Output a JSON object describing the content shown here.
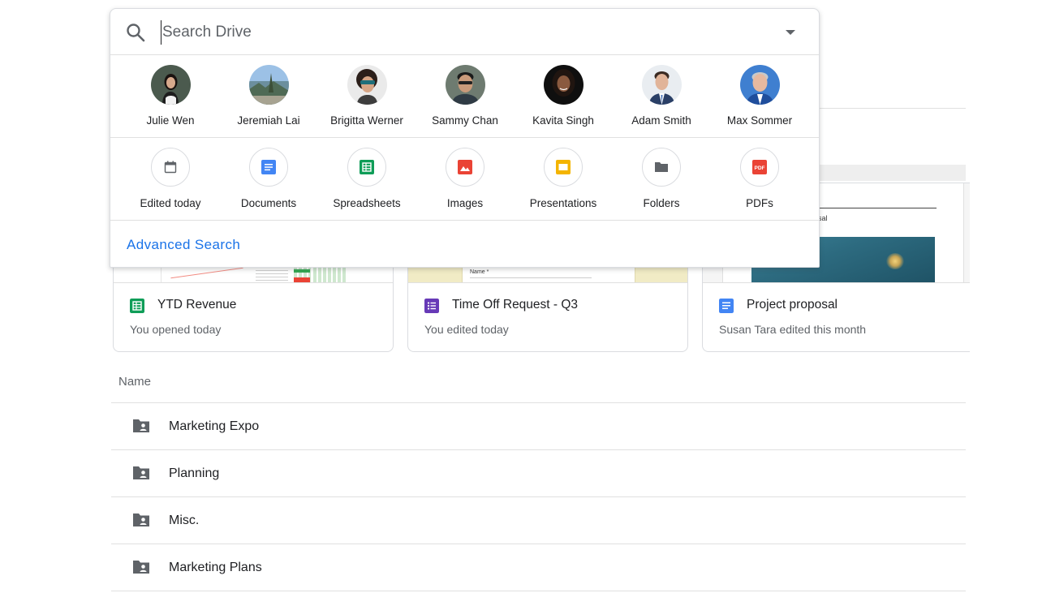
{
  "search": {
    "placeholder": "Search Drive"
  },
  "people": [
    {
      "name": "Julie Wen"
    },
    {
      "name": "Jeremiah Lai"
    },
    {
      "name": "Brigitta Werner"
    },
    {
      "name": "Sammy Chan"
    },
    {
      "name": "Kavita Singh"
    },
    {
      "name": "Adam Smith"
    },
    {
      "name": "Max Sommer"
    }
  ],
  "types": [
    {
      "label": "Edited today",
      "icon": "calendar-icon"
    },
    {
      "label": "Documents",
      "icon": "docs-icon"
    },
    {
      "label": "Spreadsheets",
      "icon": "sheets-icon"
    },
    {
      "label": "Images",
      "icon": "image-icon"
    },
    {
      "label": "Presentations",
      "icon": "slides-icon"
    },
    {
      "label": "Folders",
      "icon": "folder-icon"
    },
    {
      "label": "PDFs",
      "icon": "pdf-icon"
    }
  ],
  "advanced_search": "Advanced Search",
  "thumb_text": {
    "form_label": "Name *",
    "doc_snippet": "posal"
  },
  "cards": [
    {
      "title": "YTD Revenue",
      "subtitle": "You opened today",
      "icon": "sheets-icon",
      "color": "#0f9d58"
    },
    {
      "title": "Time Off Request - Q3",
      "subtitle": "You edited today",
      "icon": "forms-icon",
      "color": "#673ab7"
    },
    {
      "title": "Project proposal",
      "subtitle": "Susan Tara edited this month",
      "icon": "docs-icon",
      "color": "#4285f4"
    }
  ],
  "list": {
    "header": "Name",
    "rows": [
      {
        "name": "Marketing Expo"
      },
      {
        "name": "Planning"
      },
      {
        "name": "Misc."
      },
      {
        "name": "Marketing Plans"
      }
    ]
  },
  "colors": {
    "accent": "#1a73e8",
    "docs": "#4285f4",
    "sheets": "#0f9d58",
    "slides": "#f4b400",
    "images": "#ea4335",
    "forms": "#673ab7",
    "icon_gray": "#5f6368"
  }
}
